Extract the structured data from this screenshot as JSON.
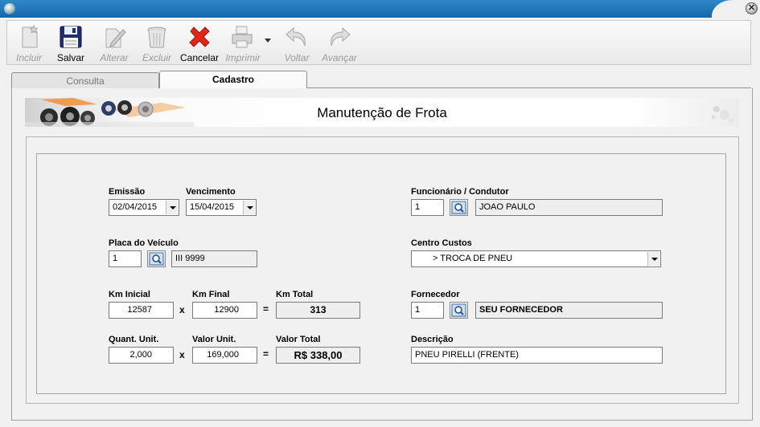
{
  "window": {
    "system_icon": "app-orb-icon",
    "close_icon": "close-icon",
    "close_glyph": "✕"
  },
  "toolbar": {
    "buttons": [
      {
        "label": "Incluir",
        "icon": "new-document-icon",
        "enabled": false
      },
      {
        "label": "Salvar",
        "icon": "floppy-disk-icon",
        "enabled": true
      },
      {
        "label": "Alterar",
        "icon": "edit-pen-icon",
        "enabled": false
      },
      {
        "label": "Excluir",
        "icon": "trash-can-icon",
        "enabled": false
      },
      {
        "label": "Cancelar",
        "icon": "red-x-icon",
        "enabled": true
      },
      {
        "label": "Imprimir",
        "icon": "printer-icon",
        "enabled": false
      },
      {
        "label": "Voltar",
        "icon": "undo-arrow-icon",
        "enabled": false
      },
      {
        "label": "Avançar",
        "icon": "redo-arrow-icon",
        "enabled": false
      }
    ]
  },
  "tabs": [
    {
      "label": "Consulta",
      "active": false
    },
    {
      "label": "Cadastro",
      "active": true
    }
  ],
  "header": {
    "title": "Manutenção de Frota"
  },
  "form": {
    "emissao": {
      "label": "Emissão",
      "value": "02/04/2015"
    },
    "vencimento": {
      "label": "Vencimento",
      "value": "15/04/2015"
    },
    "placa": {
      "label": "Placa do Veículo",
      "code": "1",
      "description": "III 9999"
    },
    "km_inicial": {
      "label": "Km Inicial",
      "value": "12587"
    },
    "km_final": {
      "label": "Km Final",
      "value": "12900"
    },
    "km_total": {
      "label": "Km Total",
      "value": "313"
    },
    "quant_unit": {
      "label": "Quant. Unit.",
      "value": "2,000"
    },
    "valor_unit": {
      "label": "Valor Unit.",
      "value": "169,000"
    },
    "valor_total": {
      "label": "Valor Total",
      "value": "R$ 338,00"
    },
    "times_symbol": "x",
    "equals_symbol": "=",
    "funcionario": {
      "label": "Funcionário / Condutor",
      "code": "1",
      "description": "JOAO PAULO"
    },
    "centro_custos": {
      "label": "Centro Custos",
      "value": "> TROCA DE PNEU"
    },
    "fornecedor": {
      "label": "Fornecedor",
      "code": "1",
      "description": "SEU FORNECEDOR"
    },
    "descricao": {
      "label": "Descrição",
      "value": "PNEU PIRELLI (FRENTE)"
    }
  },
  "colors": {
    "titlebar": "#1a6fb0",
    "cancel_red": "#e0261b"
  }
}
